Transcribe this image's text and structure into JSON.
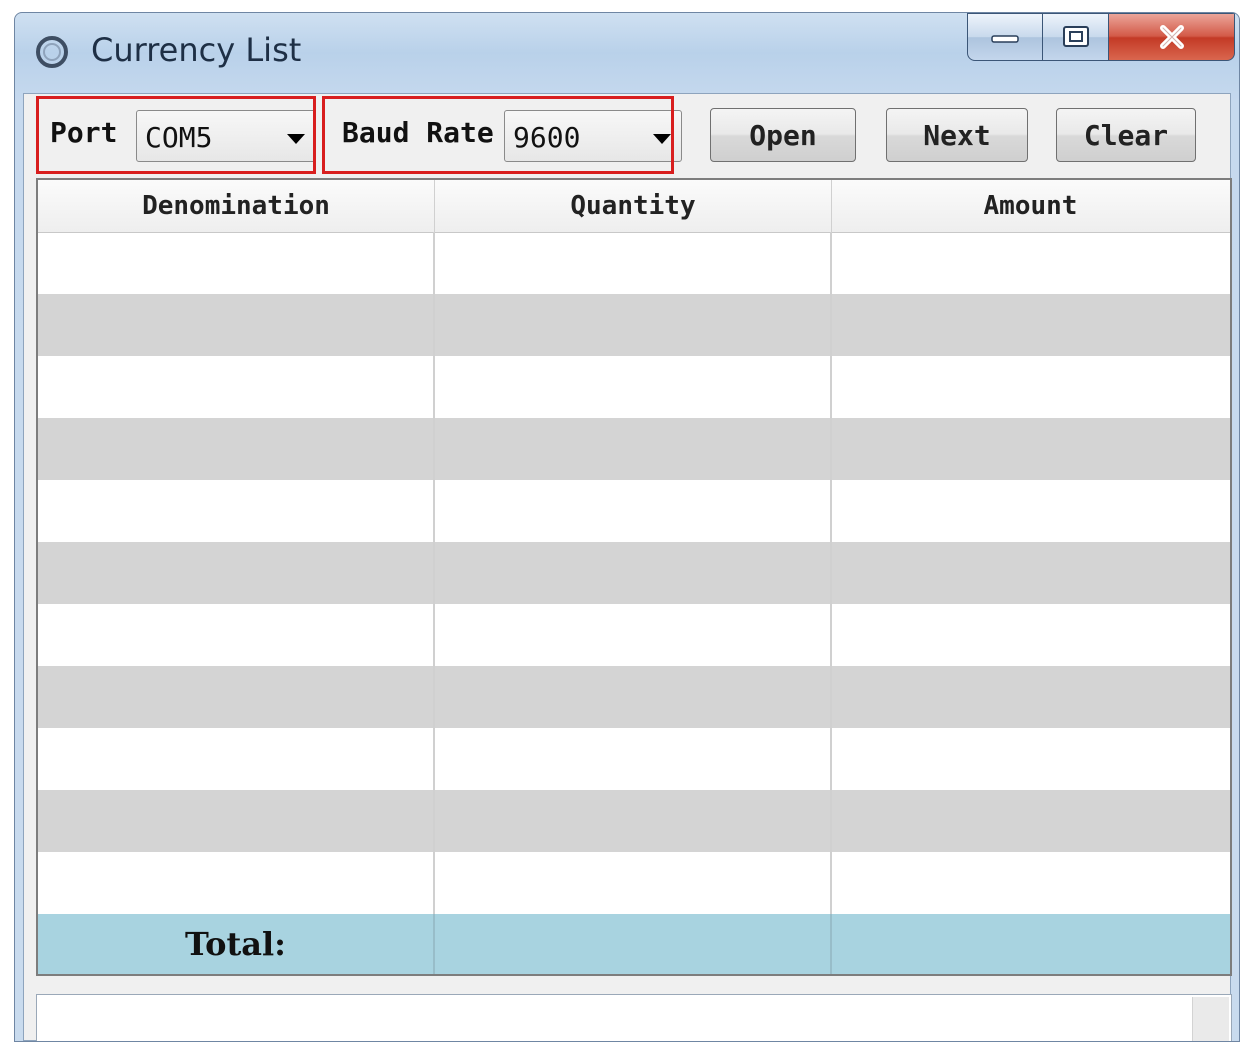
{
  "window": {
    "title": "Currency List",
    "icon": "app-circle-icon",
    "caption_buttons": [
      "minimize-icon",
      "maximize-icon",
      "close-icon"
    ]
  },
  "toolbar": {
    "port_label": "Port",
    "port_value": "COM5",
    "baud_label": "Baud Rate",
    "baud_value": "9600",
    "open_label": "Open",
    "next_label": "Next",
    "clear_label": "Clear",
    "highlight_color": "#d81e1e"
  },
  "table": {
    "columns": [
      "Denomination",
      "Quantity",
      "Amount"
    ],
    "rows": [
      [
        "",
        "",
        ""
      ],
      [
        "",
        "",
        ""
      ],
      [
        "",
        "",
        ""
      ],
      [
        "",
        "",
        ""
      ],
      [
        "",
        "",
        ""
      ],
      [
        "",
        "",
        ""
      ],
      [
        "",
        "",
        ""
      ],
      [
        "",
        "",
        ""
      ],
      [
        "",
        "",
        ""
      ],
      [
        "",
        "",
        ""
      ],
      [
        "",
        "",
        ""
      ]
    ],
    "total_label": "Total:",
    "total_quantity": "",
    "total_amount": "",
    "alt_row_color": "#d4d4d4",
    "total_row_color": "#a8d3e0"
  }
}
